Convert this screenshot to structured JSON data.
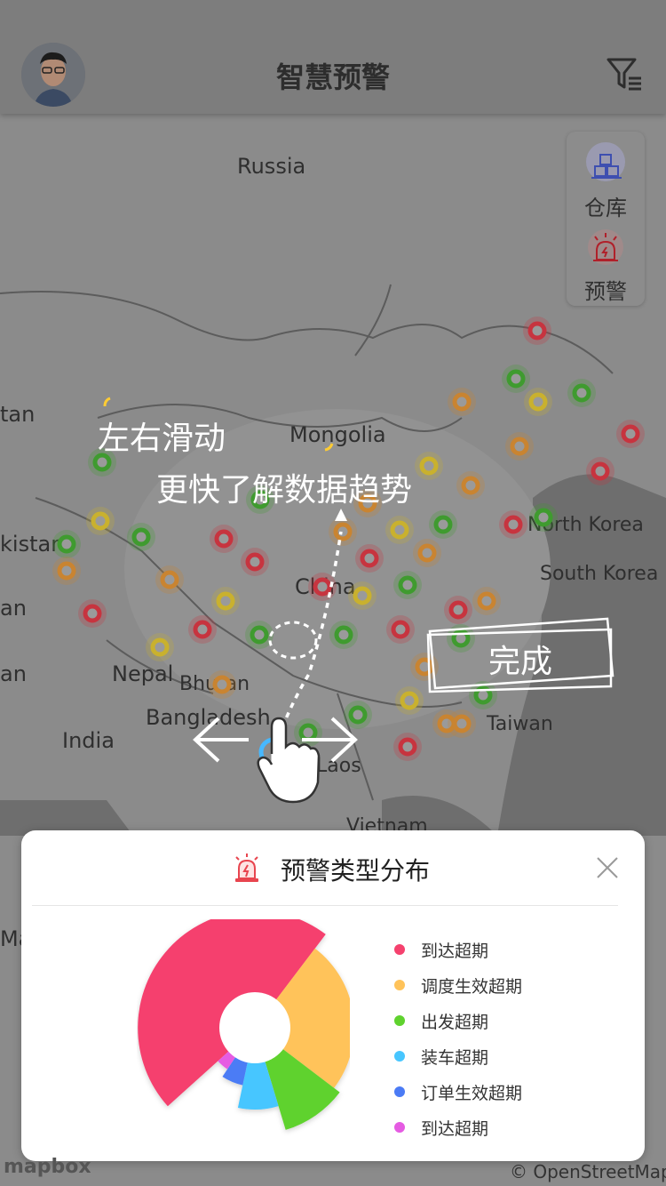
{
  "header": {
    "title": "智慧预警"
  },
  "side_panel": {
    "warehouse_label": "仓库",
    "alert_label": "预警"
  },
  "map": {
    "labels": {
      "russia": "Russia",
      "mongolia": "Mongolia",
      "china": "China",
      "north_korea": "North Korea",
      "south_korea": "South Korea",
      "nepal": "Nepal",
      "bhutan": "Bhutan",
      "bangladesh": "Bangladesh",
      "india": "India",
      "taiwan": "Taiwan",
      "laos": "Laos",
      "vietnam": "Vietnam",
      "edge_tan": "tan",
      "edge_kistan": "kistan",
      "edge_an1": "an",
      "edge_an2": "an",
      "edge_ma": "Ma"
    },
    "colors": {
      "red": "#c7343f",
      "orange": "#c98431",
      "yellow": "#c9b12e",
      "green": "#3f9b2f"
    }
  },
  "guide": {
    "line1": "左右滑动",
    "line2": "更快了解数据趋势",
    "done_label": "完成"
  },
  "card": {
    "title": "预警类型分布",
    "icon": "alarm-icon",
    "legend": [
      {
        "label": "到达超期",
        "color": "#f5416e"
      },
      {
        "label": "调度生效超期",
        "color": "#ffc35a"
      },
      {
        "label": "出发超期",
        "color": "#5fd22e"
      },
      {
        "label": "装车超期",
        "color": "#47c6ff"
      },
      {
        "label": "订单生效超期",
        "color": "#4b7bf5"
      },
      {
        "label": "到达超期",
        "color": "#e55be2"
      }
    ]
  },
  "chart_data": {
    "type": "pie",
    "categories": [
      "到达超期",
      "调度生效超期",
      "出发超期",
      "装车超期",
      "订单生效超期",
      "到达超期"
    ],
    "values": [
      47,
      25,
      10,
      8,
      6,
      4
    ],
    "colors": [
      "#f5416e",
      "#ffc35a",
      "#5fd22e",
      "#47c6ff",
      "#4b7bf5",
      "#e55be2"
    ]
  },
  "attribution": {
    "left": "mapbox",
    "right": "© OpenStreetMap"
  }
}
